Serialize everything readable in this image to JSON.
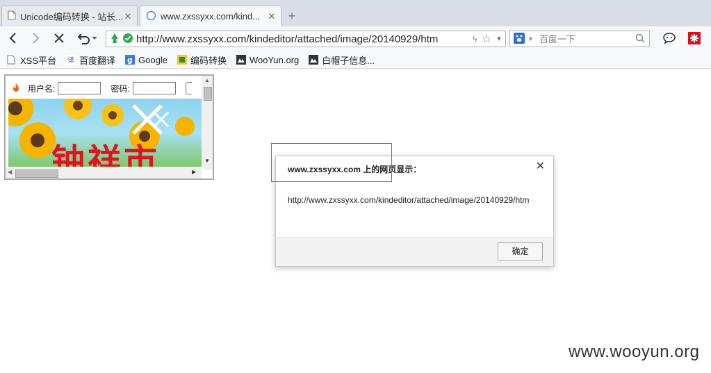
{
  "browser": {
    "tabs": [
      {
        "title": "Unicode编码转换 - 站长...",
        "icon": "document-icon",
        "active": false
      },
      {
        "title": "www.zxssyxx.com/kind...",
        "icon": "loading-globe-icon",
        "active": true
      }
    ],
    "new_tab_label": "+",
    "address": {
      "url": "http://www.zxssyxx.com/kindeditor/attached/image/20140929/htm"
    },
    "search": {
      "placeholder": "百度一下"
    },
    "bookmarks": [
      {
        "label": "XSS平台",
        "icon": "page-icon"
      },
      {
        "label": "百度翻译",
        "icon": "translate-icon"
      },
      {
        "label": "Google",
        "icon": "google-icon"
      },
      {
        "label": "编码转换",
        "icon": "encode-icon"
      },
      {
        "label": "WooYun.org",
        "icon": "wooyun-icon"
      },
      {
        "label": "白帽子信息...",
        "icon": "whitehat-icon"
      }
    ]
  },
  "page": {
    "login": {
      "username_label": "用户名:",
      "password_label": "密码:"
    },
    "banner_text": "钟祥市"
  },
  "dialog": {
    "title": "www.zxssyxx.com 上的网页显示：",
    "message": "http://www.zxssyxx.com/kindeditor/attached/image/20140929/htm",
    "ok_label": "确定",
    "close_label": "✕"
  },
  "watermark": "www.wooyun.org",
  "colors": {
    "accent_green": "#2fa84f",
    "highlight_red": "#e0403a",
    "banner_text": "#e0141e"
  }
}
